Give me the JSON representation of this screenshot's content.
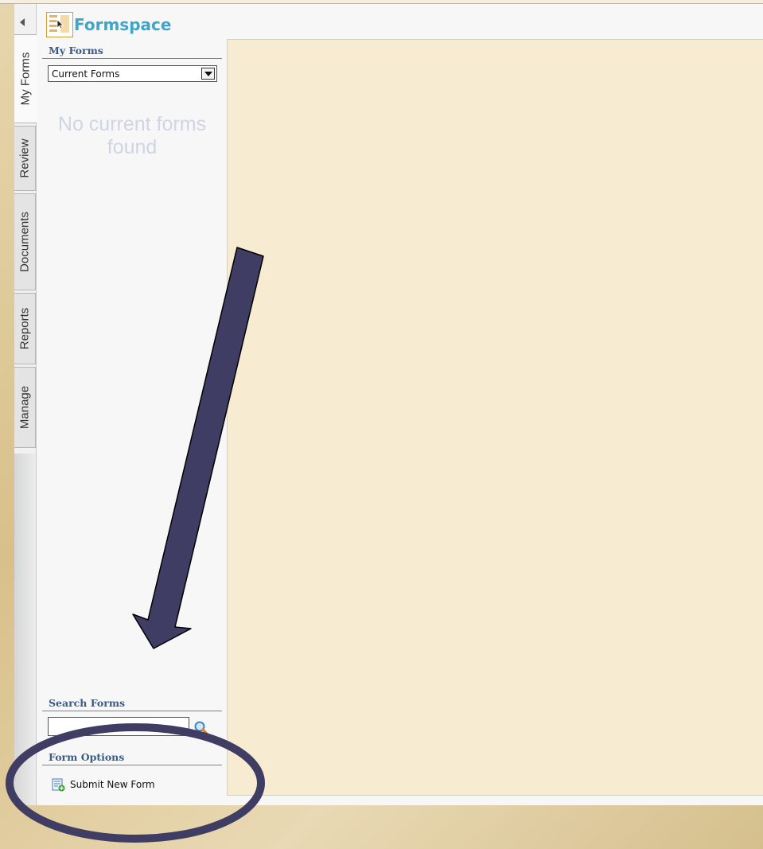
{
  "app": {
    "name": "Formspace"
  },
  "tabs": [
    {
      "label": "My Forms",
      "active": true
    },
    {
      "label": "Review",
      "active": false
    },
    {
      "label": "Documents",
      "active": false
    },
    {
      "label": "Reports",
      "active": false
    },
    {
      "label": "Manage",
      "active": false
    }
  ],
  "sidebar": {
    "my_forms_heading": "My Forms",
    "filter_selected": "Current Forms",
    "empty_message": "No current forms found",
    "search_heading": "Search Forms",
    "search_value": "",
    "options_heading": "Form Options",
    "options": [
      {
        "label": "Submit New Form",
        "icon": "form-add-icon"
      }
    ]
  },
  "annotations": {
    "arrow_color": "#3f3d63",
    "ellipse_color": "#3f3d63"
  },
  "colors": {
    "accent": "#3ea6c8",
    "heading": "#3a5b86",
    "main_bg": "#f7ebd2"
  }
}
